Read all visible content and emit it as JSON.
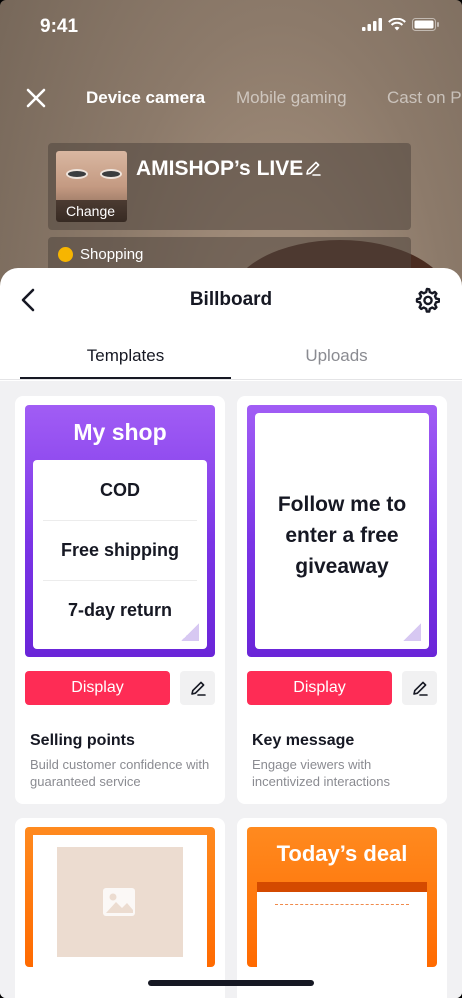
{
  "status": {
    "time": "9:41"
  },
  "camera_tabs": [
    {
      "label": "Device camera"
    },
    {
      "label": "Mobile gaming"
    },
    {
      "label": "Cast on P"
    }
  ],
  "live": {
    "title": "AMISHOP’s LIVE",
    "change_label": "Change",
    "shopping_label": "Shopping"
  },
  "sheet": {
    "title": "Billboard",
    "tabs": [
      {
        "label": "Templates"
      },
      {
        "label": "Uploads"
      }
    ]
  },
  "cards": [
    {
      "poster_title": "My shop",
      "rows": [
        "COD",
        "Free shipping",
        "7-day return"
      ],
      "display_label": "Display",
      "title": "Selling points",
      "description": "Build customer confidence with guaranteed service"
    },
    {
      "poster_text": "Follow me to enter a free giveaway",
      "display_label": "Display",
      "title": "Key message",
      "description": "Engage viewers with incentivized interactions"
    },
    {
      "poster_title": ""
    },
    {
      "poster_title": "Today’s deal"
    }
  ],
  "colors": {
    "accent": "#fe2c55",
    "purple": "#7a34e6",
    "orange": "#ff6a00"
  }
}
